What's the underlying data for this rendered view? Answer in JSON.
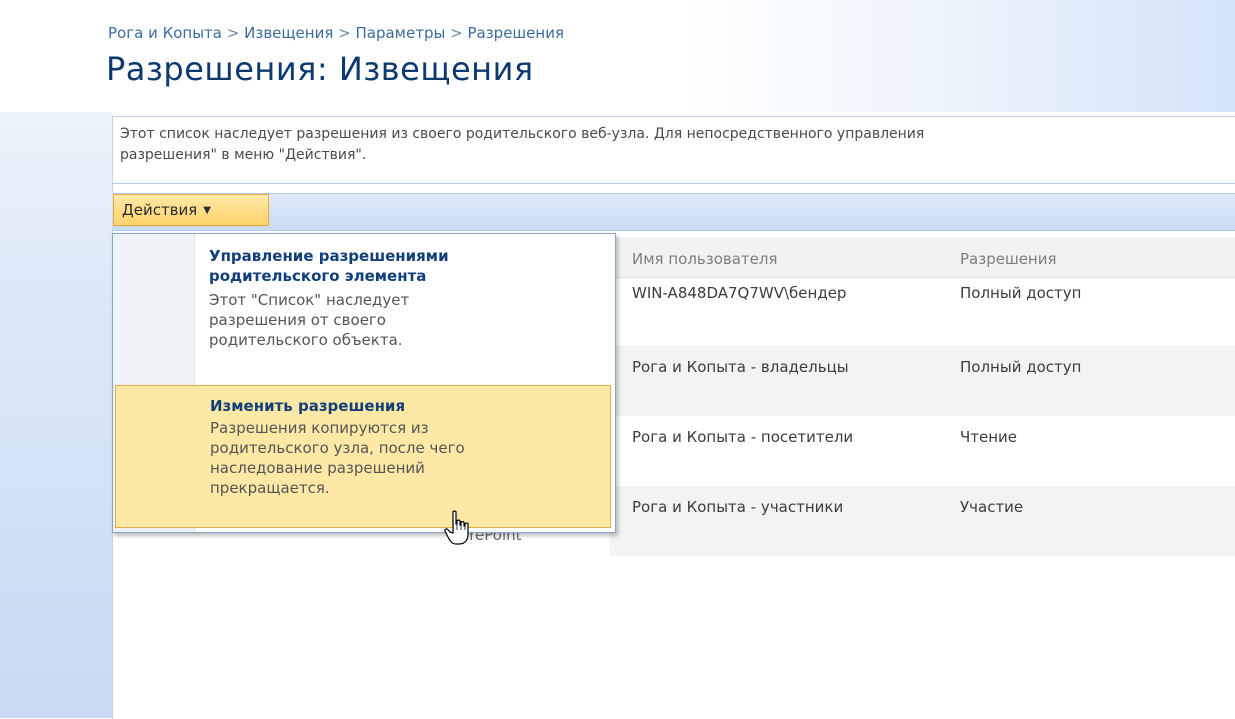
{
  "breadcrumb": {
    "items": [
      "Рога и Копыта",
      "Извещения",
      "Параметры",
      "Разрешения"
    ],
    "separator": ">"
  },
  "page_title": "Разрешения: Извещения",
  "info_text": "Этот список наследует разрешения из своего родительского веб-узла. Для непосредственного управления разрешения\" в меню \"Действия\".",
  "info_text_lines": [
    "Этот список наследует разрешения из своего родительского веб-узла. Для непосредственного управления",
    "разрешения\" в меню \"Действия\"."
  ],
  "toolbar": {
    "actions_label": "Действия",
    "actions_arrow_icon": "chevron-down-icon"
  },
  "actions_menu": {
    "items": [
      {
        "title": "Управление разрешениями родительского элемента",
        "description": "Этот \"Список\" наследует разрешения от своего родительского объекта."
      },
      {
        "title": "Изменить разрешения",
        "description": "Разрешения копируются из родительского узла, после чего наследование разрешений прекращается."
      }
    ]
  },
  "table": {
    "headers": [
      "Имя пользователя",
      "Разрешения"
    ],
    "rows": [
      {
        "user": "WIN-A848DA7Q7WV\\бендер",
        "permission": "Полный доступ"
      },
      {
        "user": "Рога и Копыта - владельцы",
        "permission": "Полный доступ"
      },
      {
        "user": "Рога и Копыта - посетители",
        "permission": "Чтение"
      },
      {
        "user": "Рога и Копыта - участники",
        "permission": "Участие"
      }
    ]
  },
  "obscured_text": "arePoint",
  "colors": {
    "title": "#0c3a6e",
    "link": "#3c6b9e",
    "menu_highlight": "#fde8a5",
    "actions_button": "#fdd36a"
  },
  "cursor_icon": "hand-pointer-icon"
}
